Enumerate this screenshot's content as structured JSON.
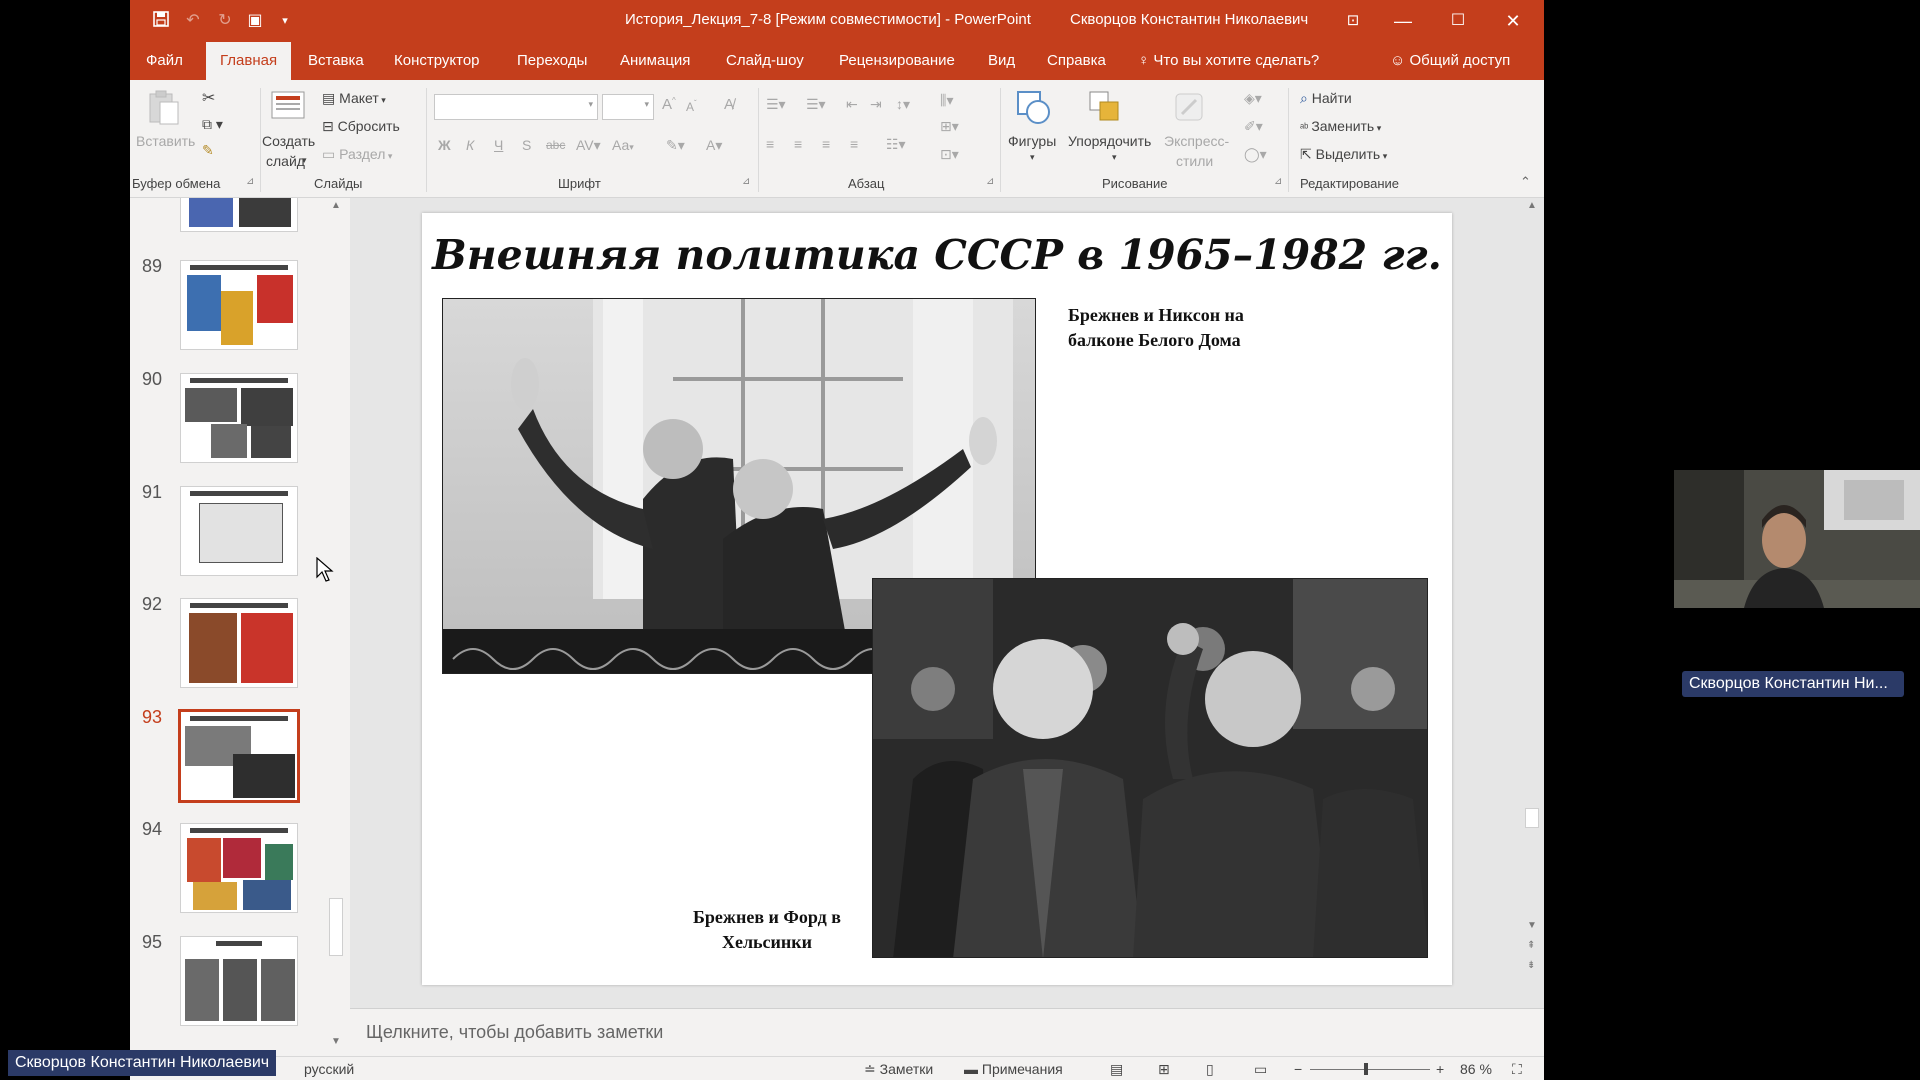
{
  "window": {
    "title": "История_Лекция_7-8 [Режим совместимости]  -  PowerPoint",
    "user": "Скворцов Константин Николаевич"
  },
  "menu": {
    "tabs": [
      "Файл",
      "Главная",
      "Вставка",
      "Конструктор",
      "Переходы",
      "Анимация",
      "Слайд-шоу",
      "Рецензирование",
      "Вид",
      "Справка"
    ],
    "tell_me": "Что вы хотите сделать?",
    "share": "Общий доступ"
  },
  "ribbon": {
    "paste": "Вставить",
    "new_slide_1": "Создать",
    "new_slide_2": "слайд",
    "layout": "Макет",
    "reset": "Сбросить",
    "section": "Раздел",
    "bold": "Ж",
    "italic": "К",
    "underline": "Ч",
    "shadow": "S",
    "strike": "abc",
    "case": "Аа",
    "shapes": "Фигуры",
    "arrange": "Упорядочить",
    "quick_styles_1": "Экспресс-",
    "quick_styles_2": "стили",
    "find": "Найти",
    "replace": "Заменить",
    "select": "Выделить",
    "groups": {
      "clipboard": "Буфер обмена",
      "slides": "Слайды",
      "font": "Шрифт",
      "paragraph": "Абзац",
      "drawing": "Рисование",
      "editing": "Редактирование"
    }
  },
  "thumbnails": [
    {
      "num": "89"
    },
    {
      "num": "90"
    },
    {
      "num": "91"
    },
    {
      "num": "92"
    },
    {
      "num": "93"
    },
    {
      "num": "94"
    },
    {
      "num": "95"
    }
  ],
  "slide": {
    "title": "Внешняя политика СССР в 1965–1982 гг.",
    "caption1_line1": "Брежнев и Никсон на",
    "caption1_line2": "балконе Белого Дома",
    "caption2_line1": "Брежнев и Форд в",
    "caption2_line2": "Хельсинки"
  },
  "notes_placeholder": "Щелкните, чтобы добавить заметки",
  "status": {
    "language": "русский",
    "notes": "Заметки",
    "comments": "Примечания",
    "zoom": "86 %"
  },
  "video": {
    "participant_tag": "Скворцов Константин Ни...",
    "presenter_tag": "Скворцов Константин Николаевич"
  },
  "colors": {
    "accent": "#c43e1c",
    "tag_bg": "#2b3a67"
  }
}
